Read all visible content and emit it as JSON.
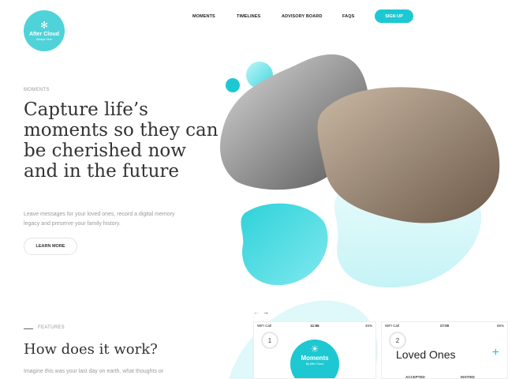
{
  "brand": {
    "name": "After Cloud",
    "tagline": "Always Here",
    "mark": "✻"
  },
  "nav": {
    "items": [
      "MOMENTS",
      "TIMELINES",
      "ADVISORY BOARD",
      "FAQS"
    ],
    "signup": "SIGN UP"
  },
  "hero": {
    "eyebrow": "MOMENTS",
    "title": "Capture life’s moments so they can be cherished now and in the future",
    "subtitle": "Leave messages for your loved ones, record a digital memory legacy and preserve your family history.",
    "cta": "LEARN MORE"
  },
  "features": {
    "eyebrow": "FEATURES",
    "title": "How does it work?",
    "intro": "Imagine this was your last day on earth, what thoughts or"
  },
  "carousel": {
    "prev": "←",
    "next": "→"
  },
  "phones": [
    {
      "step": "1",
      "carrier": "WiFi Call",
      "time": "11:56",
      "battery": "45%",
      "app_title": "Moments",
      "app_sub": "By After Cloud",
      "app_icon": "☀"
    },
    {
      "step": "2",
      "carrier": "WiFi Call",
      "time": "17:00",
      "battery": "66%",
      "screen_title": "Loved Ones",
      "add": "+",
      "col1": "ACCEPTED",
      "col2": "INVITED"
    }
  ],
  "colors": {
    "accent": "#1ec8d2",
    "logo": "#4fd3d8",
    "blob": "#5fe0e6"
  }
}
